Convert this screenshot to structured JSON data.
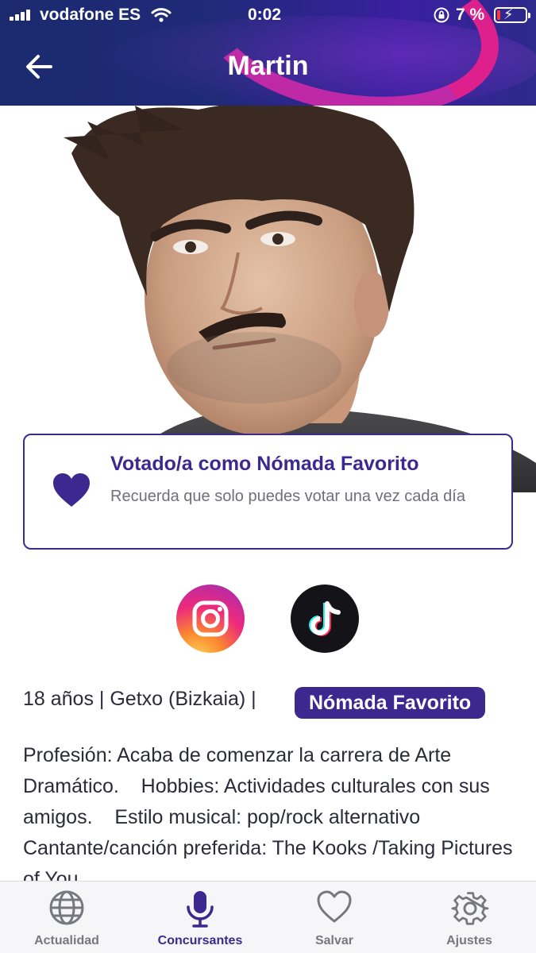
{
  "status_bar": {
    "carrier": "vodafone ES",
    "time": "0:02",
    "battery_percent": "7 %",
    "battery_level": 0.07
  },
  "header": {
    "title": "Martin",
    "back_icon": "arrow-left-icon"
  },
  "vote_card": {
    "title": "Votado/a como Nómada Favorito",
    "subtitle": "Recuerda que solo puedes votar una vez cada día",
    "icon": "heart-icon",
    "accent": "#3b2990"
  },
  "social": [
    {
      "name": "instagram",
      "icon": "instagram-icon"
    },
    {
      "name": "tiktok",
      "icon": "tiktok-icon"
    }
  ],
  "info": {
    "details": "18 años | Getxo (Bizkaia) |",
    "badge": "Nómada Favorito"
  },
  "bio": "Profesión: Acaba de comenzar la carrera de Arte Dramático.    Hobbies: Actividades culturales con sus amigos.    Estilo musical: pop/rock alternativo    Cantante/canción preferida: The Kooks /Taking Pictures of You",
  "tabbar": {
    "active": "Concursantes",
    "items": [
      {
        "label": "Actualidad",
        "icon": "globe-icon"
      },
      {
        "label": "Concursantes",
        "icon": "microphone-icon"
      },
      {
        "label": "Salvar",
        "icon": "heart-outline-icon"
      },
      {
        "label": "Ajustes",
        "icon": "gear-icon"
      }
    ]
  }
}
